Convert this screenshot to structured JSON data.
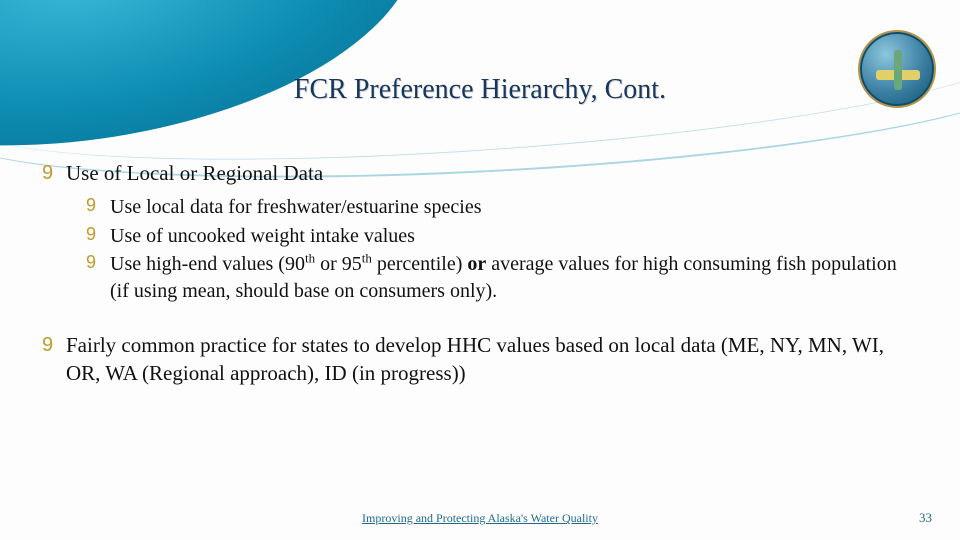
{
  "title": "FCR Preference Hierarchy, Cont.",
  "bullets": [
    {
      "text": "Use of Local or Regional Data",
      "sub": [
        "Use local data for freshwater/estuarine species",
        "Use of uncooked weight intake values",
        "Use high-end values (90<sup>th</sup> or 95<sup>th</sup> percentile) <b>or</b> average values for high consuming fish population (if using mean, should base on consumers only)."
      ]
    },
    {
      "text": "Fairly common practice for states to develop HHC values based on local data (ME, NY, MN, WI, OR, WA (Regional approach), ID (in progress))",
      "sub": []
    }
  ],
  "footer": "Improving and Protecting Alaska's Water Quality",
  "page": "33",
  "icons": {
    "bullet_glyph": "9"
  }
}
